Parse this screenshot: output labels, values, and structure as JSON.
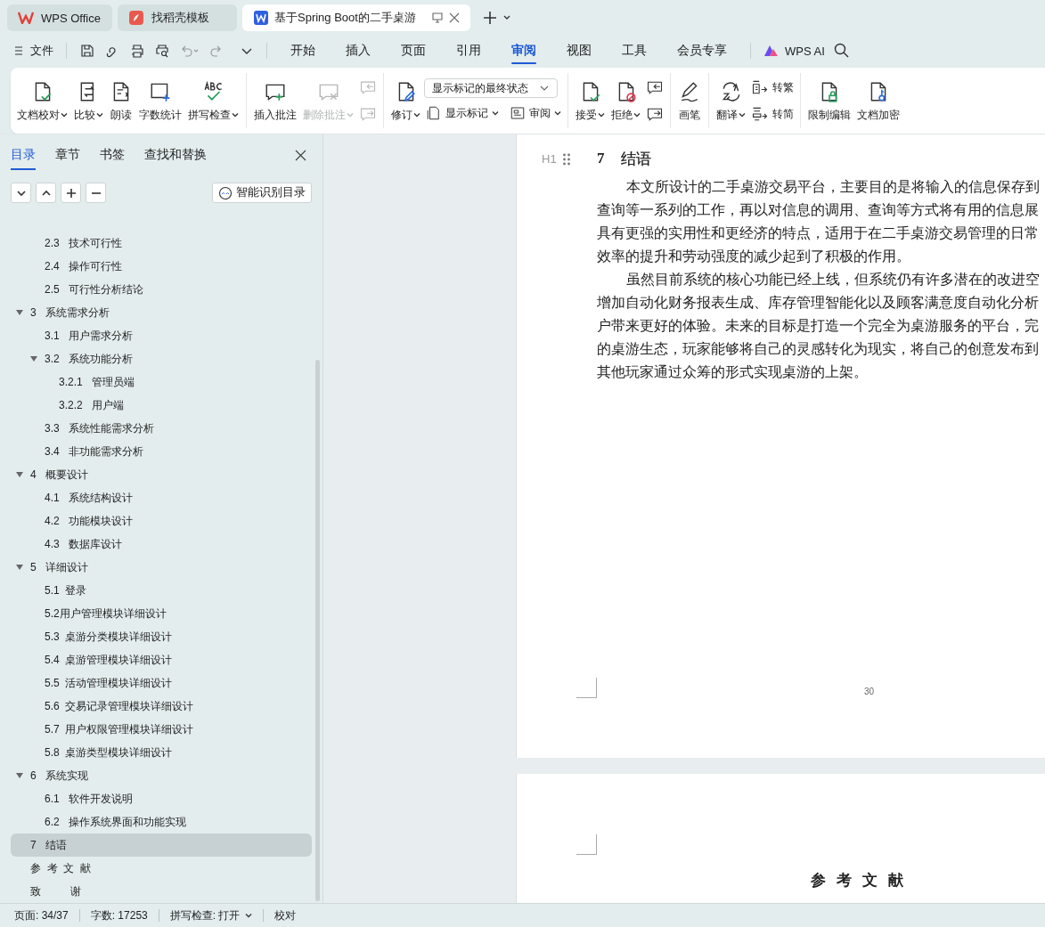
{
  "app_tabs": [
    {
      "kind": "home",
      "label": "WPS Office",
      "selected": false
    },
    {
      "kind": "template",
      "label": "找稻壳模板",
      "selected": false
    },
    {
      "kind": "doc",
      "label": "基于Spring Boot的二手桌游",
      "selected": true
    }
  ],
  "menu": {
    "file_label": "文件",
    "tabs": [
      {
        "label": "开始",
        "selected": false
      },
      {
        "label": "插入",
        "selected": false
      },
      {
        "label": "页面",
        "selected": false
      },
      {
        "label": "引用",
        "selected": false
      },
      {
        "label": "审阅",
        "selected": true
      },
      {
        "label": "视图",
        "selected": false
      },
      {
        "label": "工具",
        "selected": false
      },
      {
        "label": "会员专享",
        "selected": false
      }
    ],
    "ai_label": "WPS AI"
  },
  "ribbon": [
    [
      {
        "kind": "large",
        "label": "文档校对",
        "dropdown": true,
        "disabled": false
      },
      {
        "kind": "large",
        "label": "比较",
        "dropdown": true,
        "disabled": false
      },
      {
        "kind": "large",
        "label": "朗读",
        "dropdown": false,
        "disabled": false
      },
      {
        "kind": "large",
        "label": "字数统计",
        "dropdown": false,
        "disabled": false
      },
      {
        "kind": "large",
        "label": "拼写检查",
        "dropdown": true,
        "disabled": false
      }
    ],
    [
      {
        "kind": "large",
        "label": "插入批注",
        "dropdown": false,
        "disabled": false
      },
      {
        "kind": "large",
        "label": "删除批注",
        "dropdown": true,
        "disabled": true
      },
      {
        "kind": "stack",
        "buttons": [
          {
            "disabled": true
          },
          {
            "disabled": true
          }
        ]
      }
    ],
    [
      {
        "kind": "large",
        "label": "修订",
        "dropdown": true,
        "disabled": false
      },
      {
        "kind": "panel",
        "select": "显示标记的最终状态",
        "buttons": [
          {
            "label": "显示标记",
            "dropdown": true
          },
          {
            "label": "审阅",
            "dropdown": true
          }
        ]
      }
    ],
    [
      {
        "kind": "large",
        "label": "接受",
        "dropdown": true,
        "disabled": false
      },
      {
        "kind": "large",
        "label": "拒绝",
        "dropdown": true,
        "disabled": false
      },
      {
        "kind": "stack",
        "buttons": [
          {
            "disabled": false
          },
          {
            "disabled": false
          }
        ]
      }
    ],
    [
      {
        "kind": "large",
        "label": "画笔",
        "dropdown": false,
        "disabled": false
      }
    ],
    [
      {
        "kind": "large",
        "label": "翻译",
        "dropdown": true,
        "disabled": false
      },
      {
        "kind": "stack",
        "buttons": [
          {
            "label": "转繁",
            "disabled": false
          },
          {
            "label": "转简",
            "disabled": false
          }
        ]
      }
    ],
    [
      {
        "kind": "large",
        "label": "限制编辑",
        "dropdown": false,
        "disabled": false
      },
      {
        "kind": "large",
        "label": "文档加密",
        "dropdown": false,
        "disabled": false
      }
    ]
  ],
  "nav_panel": {
    "tabs": [
      {
        "label": "目录",
        "selected": true
      },
      {
        "label": "章节",
        "selected": false
      },
      {
        "label": "书签",
        "selected": false
      },
      {
        "label": "查找和替换",
        "selected": false
      }
    ],
    "smart_button": "智能识别目录",
    "toc": [
      {
        "children": [
          {
            "label": "2.3   技术可行性",
            "selected": false
          },
          {
            "label": "2.4   操作可行性",
            "selected": false
          },
          {
            "label": "2.5   可行性分析结论",
            "selected": false
          }
        ]
      },
      {
        "label": "3   系统需求分析",
        "expanded": true,
        "selected": false,
        "children": [
          {
            "label": "3.1   用户需求分析",
            "selected": false
          },
          {
            "label": "3.2   系统功能分析",
            "expanded": true,
            "selected": false,
            "children": [
              {
                "label": "3.2.1   管理员端",
                "selected": false
              },
              {
                "label": "3.2.2   用户端",
                "selected": false
              }
            ]
          },
          {
            "label": "3.3   系统性能需求分析",
            "selected": false
          },
          {
            "label": "3.4   非功能需求分析",
            "selected": false
          }
        ]
      },
      {
        "label": "4   概要设计",
        "expanded": true,
        "selected": false,
        "children": [
          {
            "label": "4.1   系统结构设计",
            "selected": false
          },
          {
            "label": "4.2   功能模块设计",
            "selected": false
          },
          {
            "label": "4.3   数据库设计",
            "selected": false
          }
        ]
      },
      {
        "label": "5   详细设计",
        "expanded": true,
        "selected": false,
        "children": [
          {
            "label": "5.1  登录",
            "selected": false
          },
          {
            "label": "5.2用户管理模块详细设计",
            "selected": false
          },
          {
            "label": "5.3  桌游分类模块详细设计",
            "selected": false
          },
          {
            "label": "5.4  桌游管理模块详细设计",
            "selected": false
          },
          {
            "label": "5.5  活动管理模块详细设计",
            "selected": false
          },
          {
            "label": "5.6  交易记录管理模块详细设计",
            "selected": false
          },
          {
            "label": "5.7  用户权限管理模块详细设计",
            "selected": false
          },
          {
            "label": "5.8  桌游类型模块详细设计",
            "selected": false
          }
        ]
      },
      {
        "label": "6   系统实现",
        "expanded": true,
        "selected": false,
        "children": [
          {
            "label": "6.1   软件开发说明",
            "selected": false
          },
          {
            "label": "6.2   操作系统界面和功能实现",
            "selected": false
          }
        ]
      },
      {
        "label": "7   结语",
        "selected": true
      },
      {
        "label": "参  考  文  献",
        "selected": false
      },
      {
        "label": "致          谢",
        "selected": false
      }
    ]
  },
  "document": {
    "heading_number": "7",
    "heading_title": "结语",
    "heading_marker": "H1",
    "paragraphs": [
      [
        "本文所设计的二手桌游交易平台，主要目的是将输入的信息保存到",
        "查询等一系列的工作，再以对信息的调用、查询等方式将有用的信息展",
        "具有更强的实用性和更经济的特点，适用于在二手桌游交易管理的日常",
        "效率的提升和劳动强度的减少起到了积极的作用。"
      ],
      [
        "虽然目前系统的核心功能已经上线，但系统仍有许多潜在的改进空",
        "增加自动化财务报表生成、库存管理智能化以及顾客满意度自动化分析",
        "户带来更好的体验。未来的目标是打造一个完全为桌游服务的平台，完",
        "的桌游生态，玩家能够将自己的灵感转化为现实，将自己的创意发布到",
        "其他玩家通过众筹的形式实现桌游的上架。"
      ]
    ],
    "page_number": "30",
    "next_page_heading": "参  考  文  献"
  },
  "status_bar": {
    "page": "页面: 34/37",
    "words": "字数: 17253",
    "spell": "拼写检查: 打开",
    "proof": "校对"
  }
}
